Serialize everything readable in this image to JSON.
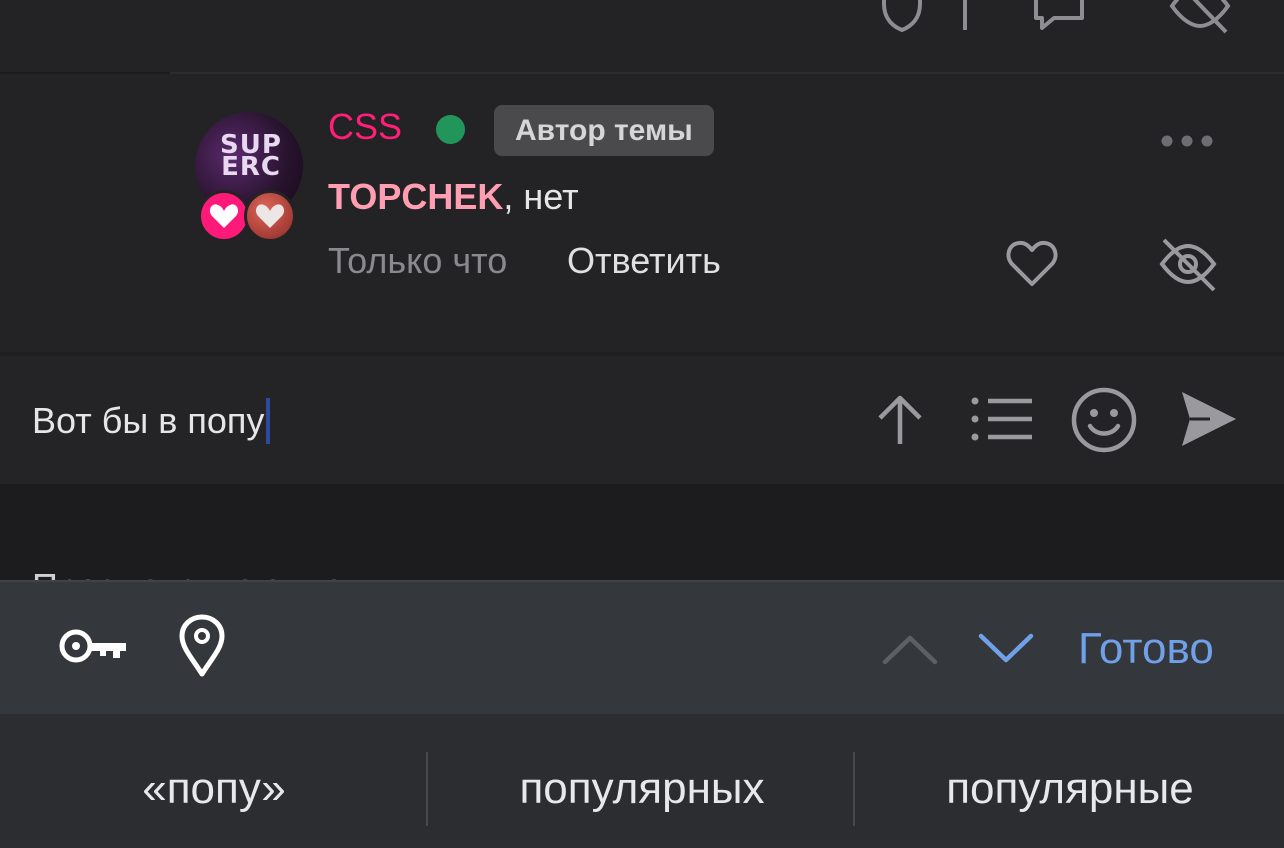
{
  "comment": {
    "username": "CSS",
    "author_badge": "Автор темы",
    "mention": "TOPCHEK",
    "message_rest": ", нет",
    "time": "Только что",
    "reply_label": "Ответить",
    "avatar_logo": "SUP ERC"
  },
  "composer": {
    "value": "Вот бы в попу"
  },
  "viewers_label": "Просматривают тему",
  "keyboard": {
    "done_label": "Готово",
    "suggestions": [
      "«попу»",
      "популярных",
      "популярные"
    ]
  },
  "colors": {
    "username": "#ff1f78",
    "mention": "#ff9eb2",
    "online": "#22955a",
    "accent": "#6fa0e8"
  },
  "icons": [
    "shield-icon",
    "comment-icon",
    "hidden-eye-icon",
    "more-dots-icon",
    "heart-icon",
    "arrow-up-icon",
    "list-icon",
    "smiley-icon",
    "send-icon",
    "key-icon",
    "location-pin-icon",
    "chevron-up-icon",
    "chevron-down-icon"
  ]
}
